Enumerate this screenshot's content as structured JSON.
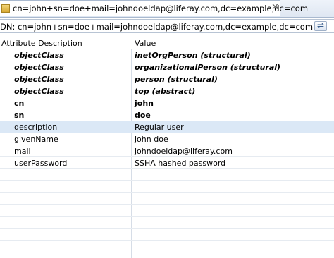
{
  "tab": {
    "title": "cn=john+sn=doe+mail=johndoeldap@liferay.com,dc=example,dc=com",
    "close": "✕"
  },
  "dn_bar": {
    "text": "DN: cn=john+sn=doe+mail=johndoeldap@liferay.com,dc=example,dc=com",
    "edit_icon": "edit-dn-icon"
  },
  "table": {
    "headers": [
      "Attribute Description",
      "Value"
    ],
    "rows": [
      {
        "attr": "objectClass",
        "value": "inetOrgPerson (structural)"
      },
      {
        "attr": "objectClass",
        "value": "organizationalPerson (structural)"
      },
      {
        "attr": "objectClass",
        "value": "person (structural)"
      },
      {
        "attr": "objectClass",
        "value": "top (abstract)"
      },
      {
        "attr": "cn",
        "value": "john"
      },
      {
        "attr": "sn",
        "value": "doe"
      },
      {
        "attr": "description",
        "value": "Regular user"
      },
      {
        "attr": "givenName",
        "value": "john doe"
      },
      {
        "attr": "mail",
        "value": "johndoeldap@liferay.com"
      },
      {
        "attr": "userPassword",
        "value": "SSHA hashed password"
      }
    ]
  }
}
